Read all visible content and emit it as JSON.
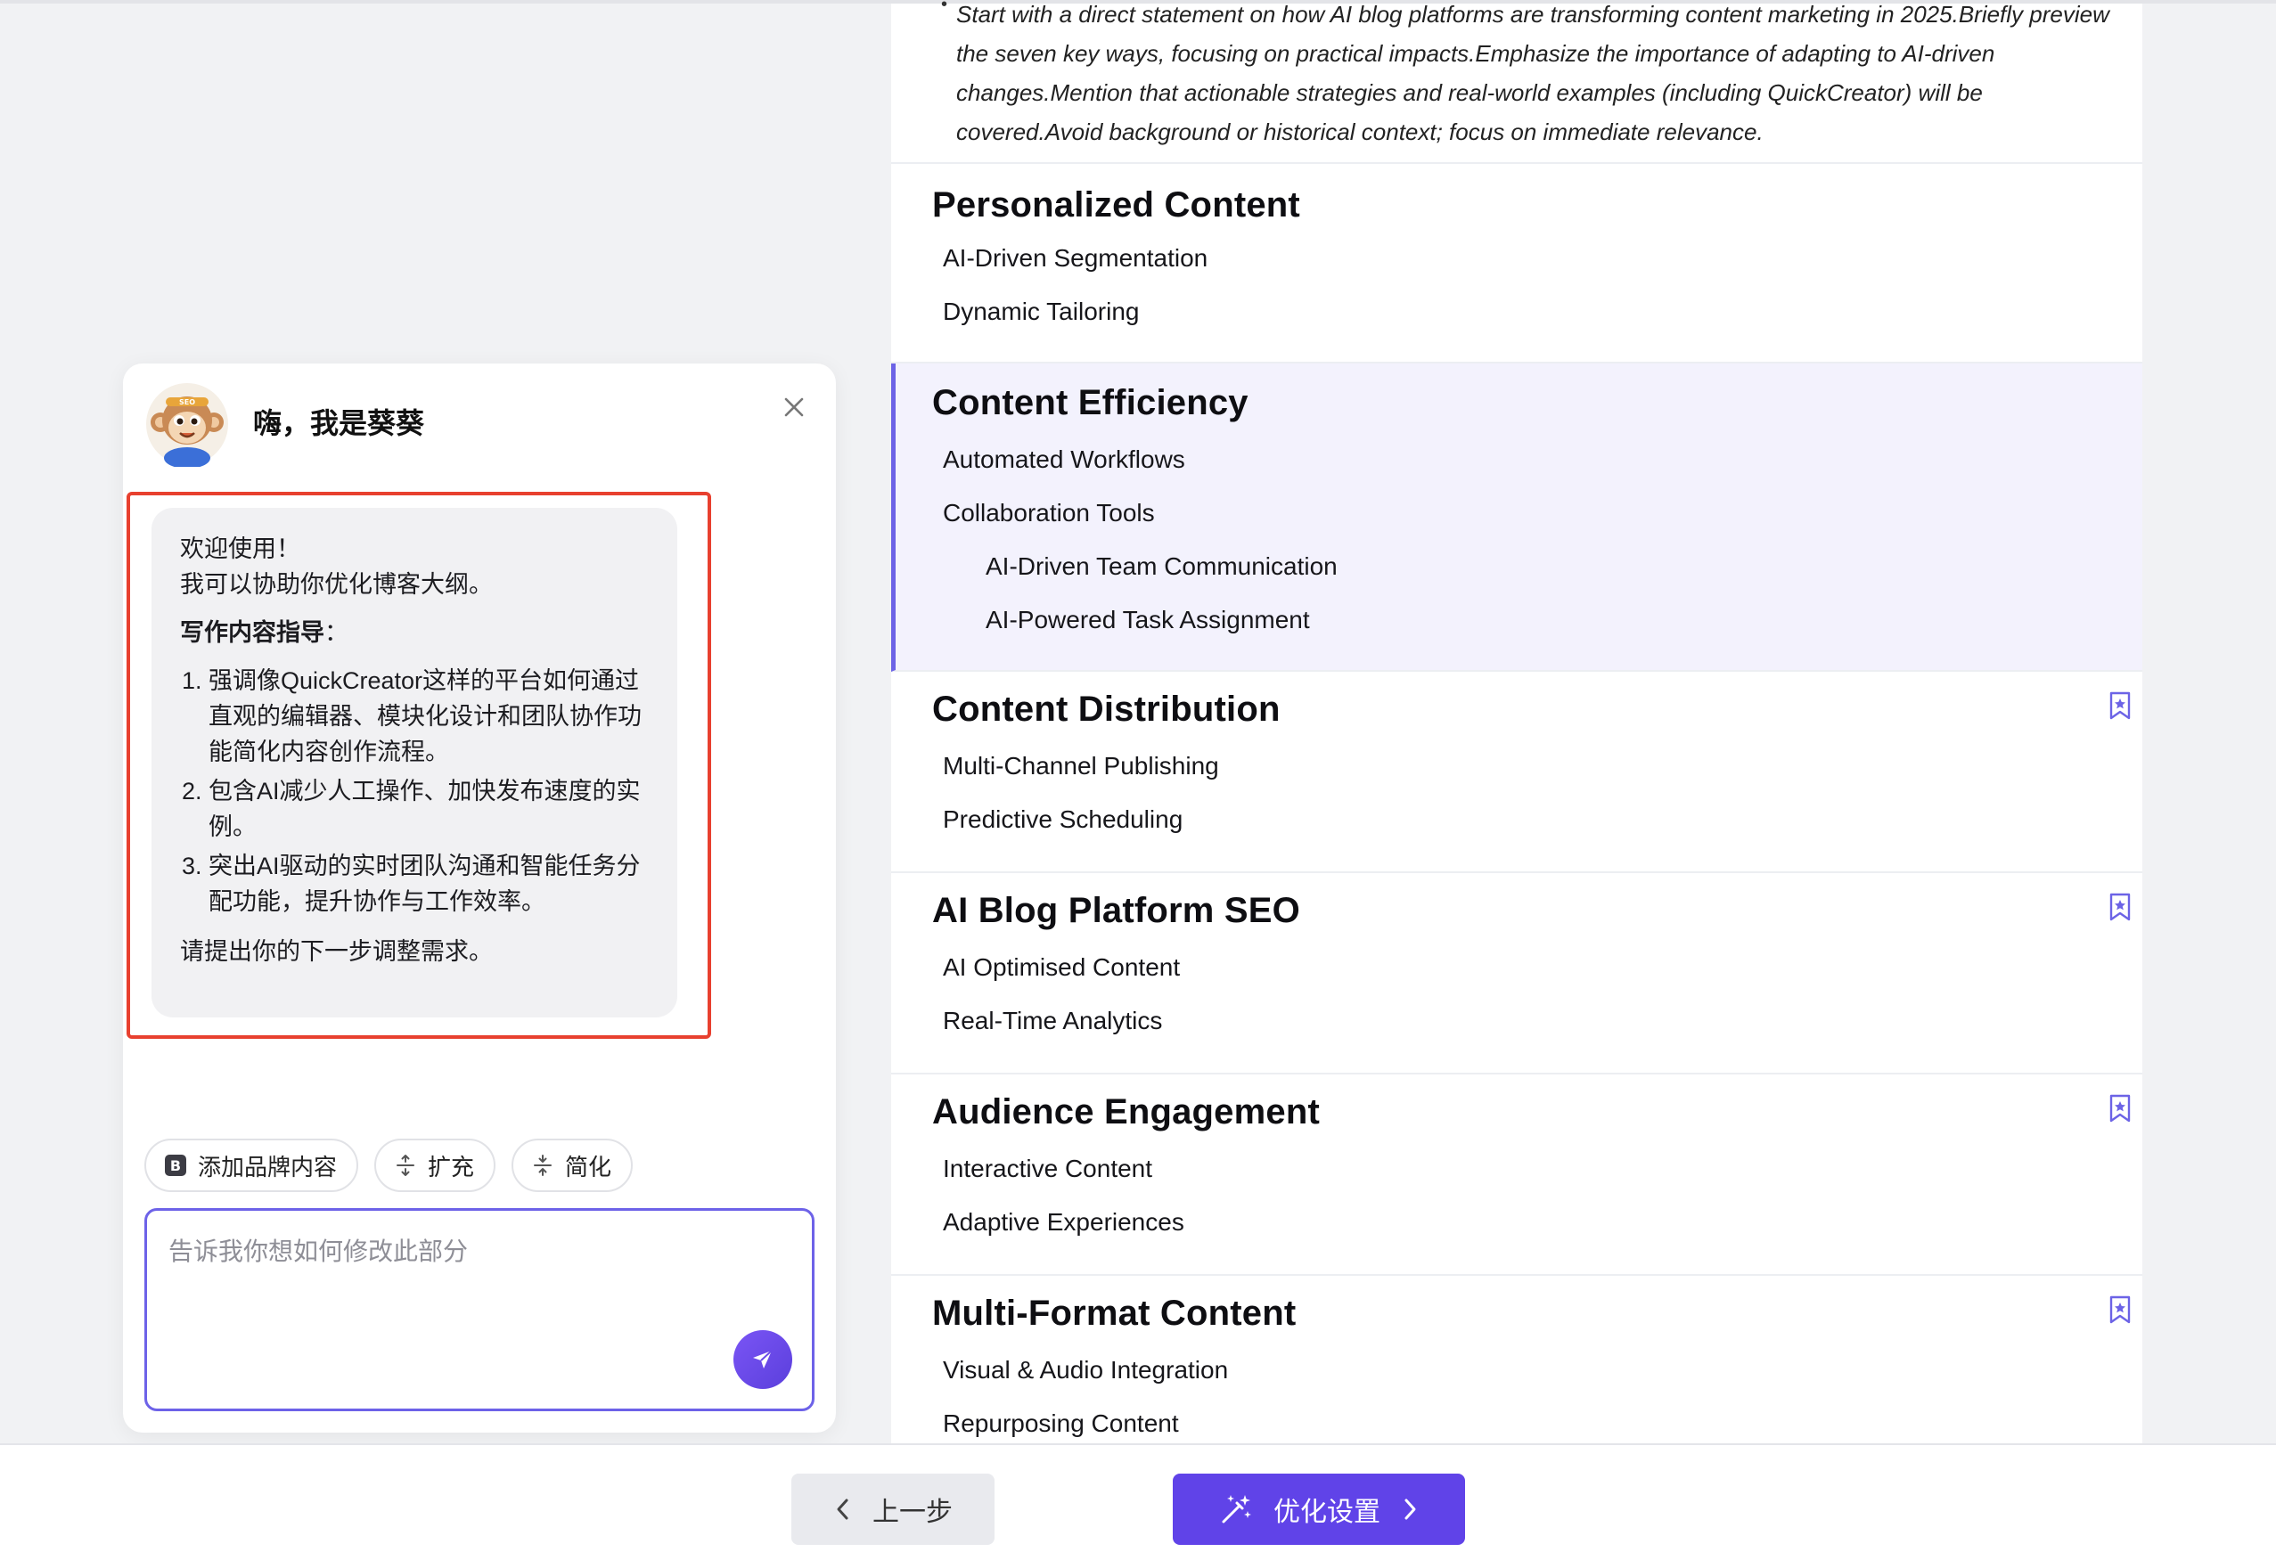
{
  "outline": {
    "intro_text": "Start with a direct statement on how AI blog platforms are transforming content marketing in 2025.Briefly preview the seven key ways, focusing on practical impacts.Emphasize the importance of adapting to AI-driven changes.Mention that actionable strategies and real-world examples (including QuickCreator) will be covered.Avoid background or historical context; focus on immediate relevance.",
    "sections": [
      {
        "title": "Personalized Content",
        "subs": [
          "AI-Driven Segmentation",
          "Dynamic Tailoring"
        ]
      },
      {
        "title": "Content Efficiency",
        "subs": [
          "Automated Workflows",
          "Collaboration Tools"
        ],
        "subsubs": [
          "AI-Driven Team Communication",
          "AI-Powered Task Assignment"
        ]
      },
      {
        "title": "Content Distribution",
        "subs": [
          "Multi-Channel Publishing",
          "Predictive Scheduling"
        ]
      },
      {
        "title": "AI Blog Platform SEO",
        "subs": [
          "AI Optimised Content",
          "Real-Time Analytics"
        ]
      },
      {
        "title": "Audience Engagement",
        "subs": [
          "Interactive Content",
          "Adaptive Experiences"
        ]
      },
      {
        "title": "Multi-Format Content",
        "subs": [
          "Visual & Audio Integration",
          "Repurposing Content"
        ]
      }
    ],
    "bookmark_icon": "bookmark-star-icon",
    "accent_color": "#6c63e6"
  },
  "chat": {
    "title": "嗨，我是葵葵",
    "avatar_icon": "monkey-avatar",
    "message": {
      "greeting": "欢迎使用！",
      "intro": "我可以协助你优化博客大纲。",
      "guide_title": "写作内容指导",
      "guide_colon": "：",
      "items": [
        "强调像QuickCreator这样的平台如何通过直观的编辑器、模块化设计和团队协作功能简化内容创作流程。",
        "包含AI减少人工操作、加快发布速度的实例。",
        "突出AI驱动的实时团队沟通和智能任务分配功能，提升协作与工作效率。"
      ],
      "closing": "请提出你的下一步调整需求。"
    },
    "chips": {
      "brand": "添加品牌内容",
      "expand": "扩充",
      "simplify": "简化"
    },
    "input": {
      "placeholder": "告诉我你想如何修改此部分",
      "value": ""
    },
    "highlight_color": "#e8402f"
  },
  "footer": {
    "prev_label": "上一步",
    "next_label": "优化设置",
    "next_color": "#6043e8"
  }
}
